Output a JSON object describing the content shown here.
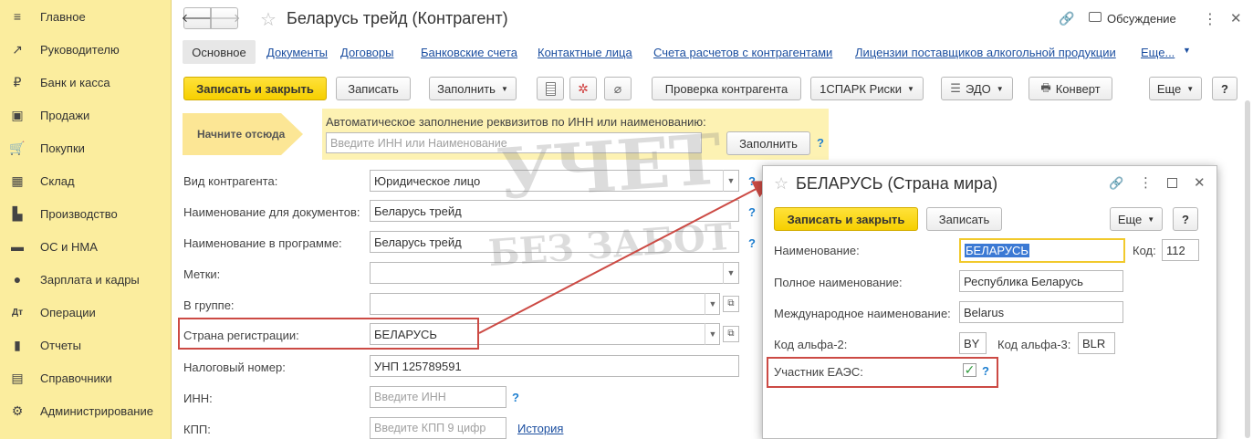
{
  "sidebar": {
    "items": [
      {
        "icon": "≡",
        "label": "Главное"
      },
      {
        "icon": "↗",
        "label": "Руководителю"
      },
      {
        "icon": "₽",
        "label": "Банк и касса"
      },
      {
        "icon": "▣",
        "label": "Продажи"
      },
      {
        "icon": "🛒",
        "label": "Покупки"
      },
      {
        "icon": "▦",
        "label": "Склад"
      },
      {
        "icon": "▙",
        "label": "Производство"
      },
      {
        "icon": "▬",
        "label": "ОС и НМА"
      },
      {
        "icon": "●",
        "label": "Зарплата и кадры"
      },
      {
        "icon": "Дт",
        "label": "Операции"
      },
      {
        "icon": "▮",
        "label": "Отчеты"
      },
      {
        "icon": "▤",
        "label": "Справочники"
      },
      {
        "icon": "⚙",
        "label": "Администрирование"
      }
    ]
  },
  "header": {
    "title": "Беларусь трейд (Контрагент)",
    "back": "🡐",
    "forward": "🡒",
    "star": "☆",
    "link_icon": "🔗",
    "discussion_label": "Обсуждение",
    "more_icon": "⋮",
    "close_icon": "✕"
  },
  "tabs": [
    {
      "label": "Основное"
    },
    {
      "label": "Документы"
    },
    {
      "label": "Договоры"
    },
    {
      "label": "Банковские счета"
    },
    {
      "label": "Контактные лица"
    },
    {
      "label": "Счета расчетов с контрагентами"
    },
    {
      "label": "Лицензии поставщиков алкогольной продукции"
    },
    {
      "label": "Еще..."
    }
  ],
  "toolbar": {
    "save_close": "Записать и закрыть",
    "save": "Записать",
    "fill": "Заполнить",
    "check": "Проверка контрагента",
    "spark": "1СПАРК Риски",
    "edo": "ЭДО",
    "envelope": "Конверт",
    "more": "Еще",
    "help": "?"
  },
  "autofill": {
    "start_label": "Начните отсюда",
    "hint": "Автоматическое заполнение реквизитов по ИНН или наименованию:",
    "placeholder": "Введите ИНН или Наименование",
    "button": "Заполнить",
    "help": "?"
  },
  "form": {
    "kind_label": "Вид контрагента:",
    "kind_value": "Юридическое лицо",
    "docname_label": "Наименование для документов:",
    "docname_value": "Беларусь трейд",
    "progname_label": "Наименование в программе:",
    "progname_value": "Беларусь трейд",
    "tags_label": "Метки:",
    "group_label": "В группе:",
    "country_label": "Страна регистрации:",
    "country_value": "БЕЛАРУСЬ",
    "tax_label": "Налоговый номер:",
    "tax_value": "УНП 125789591",
    "inn_label": "ИНН:",
    "inn_placeholder": "Введите ИНН",
    "kpp_label": "КПП:",
    "kpp_placeholder": "Введите КПП 9 цифр",
    "history_link": "История",
    "help": "?"
  },
  "popup": {
    "title": "БЕЛАРУСЬ (Страна мира)",
    "save_close": "Записать и закрыть",
    "save": "Записать",
    "more": "Еще",
    "help": "?",
    "name_label": "Наименование:",
    "name_value": "БЕЛАРУСЬ",
    "code_label": "Код:",
    "code_value": "112",
    "fullname_label": "Полное наименование:",
    "fullname_value": "Республика Беларусь",
    "intl_label": "Международное наименование:",
    "intl_value": "Belarus",
    "alpha2_label": "Код альфа-2:",
    "alpha2_value": "BY",
    "alpha3_label": "Код альфа-3:",
    "alpha3_value": "BLR",
    "eaeu_label": "Участник ЕАЭС:",
    "eaeu_checked": true
  },
  "watermark": {
    "line1": "УЧЕТ",
    "line2": "БЕЗ ЗАБОТ"
  },
  "colors": {
    "sidebar_bg": "#fbed9e",
    "accent_yellow": "#f6cf00",
    "link_blue": "#1c4fa0",
    "highlight_red": "#cc4a44",
    "check_green": "#2e9a3c"
  }
}
